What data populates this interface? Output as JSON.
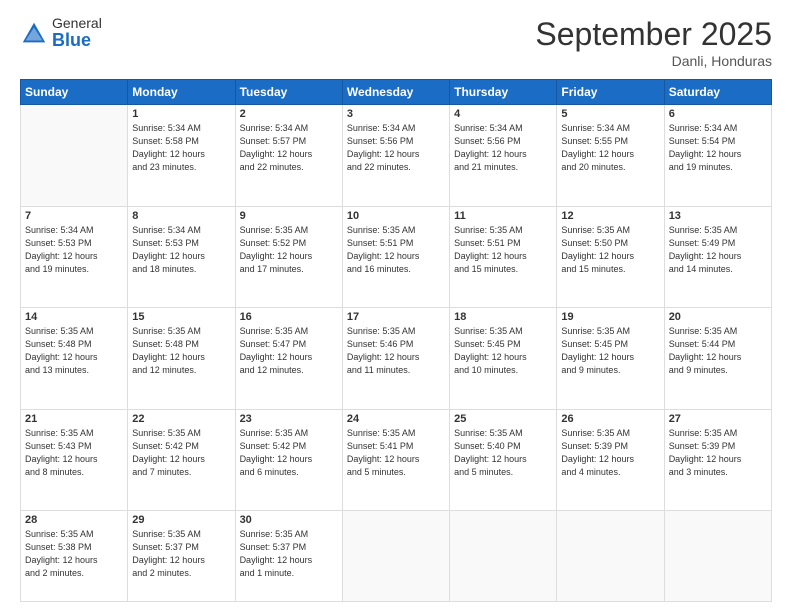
{
  "header": {
    "logo_general": "General",
    "logo_blue": "Blue",
    "month_title": "September 2025",
    "location": "Danli, Honduras"
  },
  "days_of_week": [
    "Sunday",
    "Monday",
    "Tuesday",
    "Wednesday",
    "Thursday",
    "Friday",
    "Saturday"
  ],
  "weeks": [
    [
      {
        "day": "",
        "info": ""
      },
      {
        "day": "1",
        "info": "Sunrise: 5:34 AM\nSunset: 5:58 PM\nDaylight: 12 hours\nand 23 minutes."
      },
      {
        "day": "2",
        "info": "Sunrise: 5:34 AM\nSunset: 5:57 PM\nDaylight: 12 hours\nand 22 minutes."
      },
      {
        "day": "3",
        "info": "Sunrise: 5:34 AM\nSunset: 5:56 PM\nDaylight: 12 hours\nand 22 minutes."
      },
      {
        "day": "4",
        "info": "Sunrise: 5:34 AM\nSunset: 5:56 PM\nDaylight: 12 hours\nand 21 minutes."
      },
      {
        "day": "5",
        "info": "Sunrise: 5:34 AM\nSunset: 5:55 PM\nDaylight: 12 hours\nand 20 minutes."
      },
      {
        "day": "6",
        "info": "Sunrise: 5:34 AM\nSunset: 5:54 PM\nDaylight: 12 hours\nand 19 minutes."
      }
    ],
    [
      {
        "day": "7",
        "info": "Sunrise: 5:34 AM\nSunset: 5:53 PM\nDaylight: 12 hours\nand 19 minutes."
      },
      {
        "day": "8",
        "info": "Sunrise: 5:34 AM\nSunset: 5:53 PM\nDaylight: 12 hours\nand 18 minutes."
      },
      {
        "day": "9",
        "info": "Sunrise: 5:35 AM\nSunset: 5:52 PM\nDaylight: 12 hours\nand 17 minutes."
      },
      {
        "day": "10",
        "info": "Sunrise: 5:35 AM\nSunset: 5:51 PM\nDaylight: 12 hours\nand 16 minutes."
      },
      {
        "day": "11",
        "info": "Sunrise: 5:35 AM\nSunset: 5:51 PM\nDaylight: 12 hours\nand 15 minutes."
      },
      {
        "day": "12",
        "info": "Sunrise: 5:35 AM\nSunset: 5:50 PM\nDaylight: 12 hours\nand 15 minutes."
      },
      {
        "day": "13",
        "info": "Sunrise: 5:35 AM\nSunset: 5:49 PM\nDaylight: 12 hours\nand 14 minutes."
      }
    ],
    [
      {
        "day": "14",
        "info": "Sunrise: 5:35 AM\nSunset: 5:48 PM\nDaylight: 12 hours\nand 13 minutes."
      },
      {
        "day": "15",
        "info": "Sunrise: 5:35 AM\nSunset: 5:48 PM\nDaylight: 12 hours\nand 12 minutes."
      },
      {
        "day": "16",
        "info": "Sunrise: 5:35 AM\nSunset: 5:47 PM\nDaylight: 12 hours\nand 12 minutes."
      },
      {
        "day": "17",
        "info": "Sunrise: 5:35 AM\nSunset: 5:46 PM\nDaylight: 12 hours\nand 11 minutes."
      },
      {
        "day": "18",
        "info": "Sunrise: 5:35 AM\nSunset: 5:45 PM\nDaylight: 12 hours\nand 10 minutes."
      },
      {
        "day": "19",
        "info": "Sunrise: 5:35 AM\nSunset: 5:45 PM\nDaylight: 12 hours\nand 9 minutes."
      },
      {
        "day": "20",
        "info": "Sunrise: 5:35 AM\nSunset: 5:44 PM\nDaylight: 12 hours\nand 9 minutes."
      }
    ],
    [
      {
        "day": "21",
        "info": "Sunrise: 5:35 AM\nSunset: 5:43 PM\nDaylight: 12 hours\nand 8 minutes."
      },
      {
        "day": "22",
        "info": "Sunrise: 5:35 AM\nSunset: 5:42 PM\nDaylight: 12 hours\nand 7 minutes."
      },
      {
        "day": "23",
        "info": "Sunrise: 5:35 AM\nSunset: 5:42 PM\nDaylight: 12 hours\nand 6 minutes."
      },
      {
        "day": "24",
        "info": "Sunrise: 5:35 AM\nSunset: 5:41 PM\nDaylight: 12 hours\nand 5 minutes."
      },
      {
        "day": "25",
        "info": "Sunrise: 5:35 AM\nSunset: 5:40 PM\nDaylight: 12 hours\nand 5 minutes."
      },
      {
        "day": "26",
        "info": "Sunrise: 5:35 AM\nSunset: 5:39 PM\nDaylight: 12 hours\nand 4 minutes."
      },
      {
        "day": "27",
        "info": "Sunrise: 5:35 AM\nSunset: 5:39 PM\nDaylight: 12 hours\nand 3 minutes."
      }
    ],
    [
      {
        "day": "28",
        "info": "Sunrise: 5:35 AM\nSunset: 5:38 PM\nDaylight: 12 hours\nand 2 minutes."
      },
      {
        "day": "29",
        "info": "Sunrise: 5:35 AM\nSunset: 5:37 PM\nDaylight: 12 hours\nand 2 minutes."
      },
      {
        "day": "30",
        "info": "Sunrise: 5:35 AM\nSunset: 5:37 PM\nDaylight: 12 hours\nand 1 minute."
      },
      {
        "day": "",
        "info": ""
      },
      {
        "day": "",
        "info": ""
      },
      {
        "day": "",
        "info": ""
      },
      {
        "day": "",
        "info": ""
      }
    ]
  ]
}
